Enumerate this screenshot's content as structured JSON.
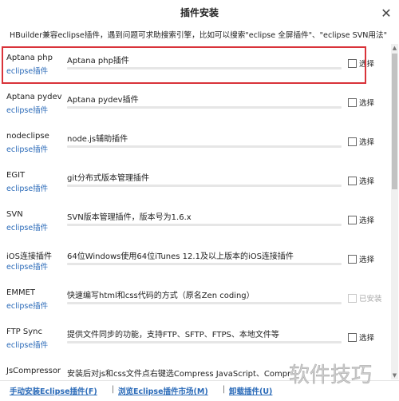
{
  "window": {
    "title": "插件安装",
    "close_glyph": "✕"
  },
  "hint": "HBuilder兼容eclipse插件，遇到问题可求助搜索引擎，比如可以搜索\"eclipse 全屏插件\"、\"eclipse SVN用法\"",
  "plugins": [
    {
      "name": "Aptana php",
      "sub": "eclipse插件",
      "desc": "Aptana php插件",
      "check_label": "选择",
      "checked": false,
      "disabled": false
    },
    {
      "name": "Aptana pydev",
      "sub": "eclipse插件",
      "desc": "Aptana pydev插件",
      "check_label": "选择",
      "checked": false,
      "disabled": false
    },
    {
      "name": "nodeclipse",
      "sub": "eclipse插件",
      "desc": "node.js辅助插件",
      "check_label": "选择",
      "checked": false,
      "disabled": false
    },
    {
      "name": "EGIT",
      "sub": "eclipse插件",
      "desc": "git分布式版本管理插件",
      "check_label": "选择",
      "checked": false,
      "disabled": false
    },
    {
      "name": "SVN",
      "sub": "eclipse插件",
      "desc": "SVN版本管理插件，版本号为1.6.x",
      "check_label": "选择",
      "checked": false,
      "disabled": false
    },
    {
      "name": "iOS连接插件",
      "sub": "eclipse插件",
      "desc": "64位Windows使用64位iTunes 12.1及以上版本的iOS连接插件",
      "check_label": "选择",
      "checked": false,
      "disabled": false
    },
    {
      "name": "EMMET",
      "sub": "eclipse插件",
      "desc": "快速编写html和css代码的方式（原名Zen coding）",
      "check_label": "已安装",
      "checked": false,
      "disabled": true
    },
    {
      "name": "FTP Sync",
      "sub": "eclipse插件",
      "desc": "提供文件同步的功能，支持FTP、SFTP、FTPS、本地文件等",
      "check_label": "选择",
      "checked": false,
      "disabled": false
    },
    {
      "name": "JsCompressor",
      "sub": "",
      "desc": "安装后对js和css文件点右键选Compress JavaScript、Compr",
      "check_label": "",
      "checked": false,
      "disabled": false
    }
  ],
  "scrollbar": {
    "up": "▲",
    "down": "▼"
  },
  "footer": {
    "manual_install": "手动安装Eclipse插件(F)",
    "browse_market": "浏览Eclipse插件市场(M)",
    "uninstall": "卸载插件(U)"
  },
  "watermark": {
    "text": "软件技巧"
  },
  "colors": {
    "link": "#2a6ab8",
    "highlight": "#d9333a"
  }
}
